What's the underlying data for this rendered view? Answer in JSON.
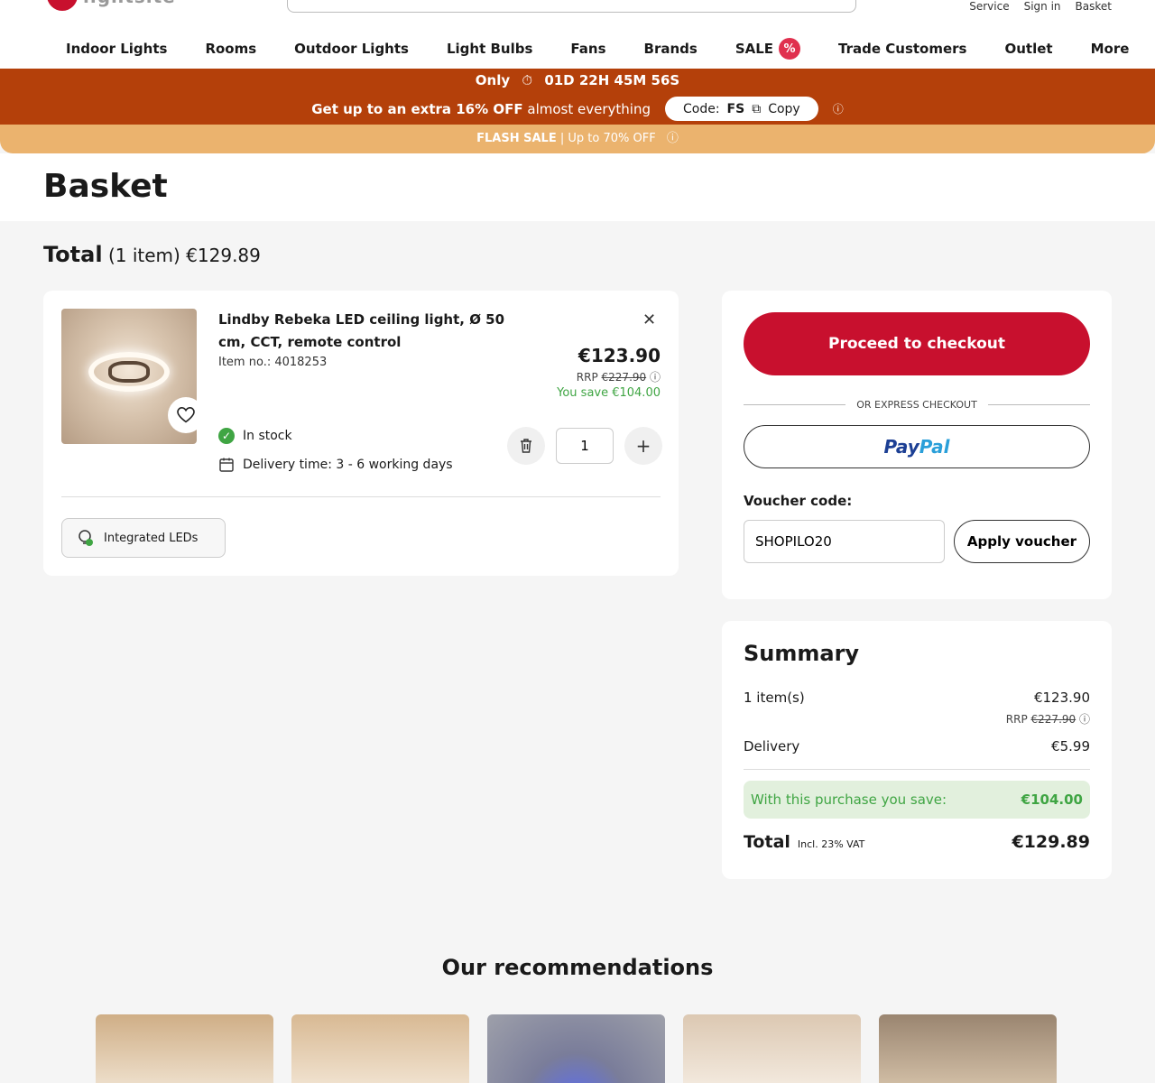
{
  "header": {
    "logo_text": "lightsite",
    "top_links": [
      "Service",
      "Sign in",
      "Basket"
    ],
    "nav": [
      "Indoor Lights",
      "Rooms",
      "Outdoor Lights",
      "Light Bulbs",
      "Fans",
      "Brands",
      "SALE",
      "Trade Customers",
      "Outlet",
      "More"
    ],
    "sale_badge": "%"
  },
  "promo": {
    "only": "Only",
    "countdown": "01D 22H 45M 56S",
    "offer_bold": "Get up to an extra 16% OFF",
    "offer_rest": "almost everything",
    "code_label": "Code:",
    "code": "FS",
    "copy_label": "Copy",
    "flash_bold": "FLASH SALE",
    "flash_rest": "| Up to 70% OFF"
  },
  "page": {
    "title": "Basket",
    "total_label": "Total",
    "total_count": "(1 item)",
    "total_amount": "€129.89"
  },
  "item": {
    "name": "Lindby Rebeka LED ceiling light, Ø 50 cm, CCT, remote control",
    "item_no": "Item no.: 4018253",
    "price": "€123.90",
    "rrp_label": "RRP",
    "rrp_value": "€227.90",
    "save": "You save €104.00",
    "stock": "In stock",
    "delivery": "Delivery time: 3 - 6 working days",
    "quantity": "1",
    "feature": "Integrated LEDs"
  },
  "checkout": {
    "proceed": "Proceed to checkout",
    "express": "OR EXPRESS CHECKOUT",
    "paypal_a": "Pay",
    "paypal_b": "Pal",
    "voucher_label": "Voucher code:",
    "voucher_value": "SHOPILO20",
    "apply": "Apply voucher"
  },
  "summary": {
    "title": "Summary",
    "items_label": "1 item(s)",
    "items_value": "€123.90",
    "rrp_label": "RRP",
    "rrp_value": "€227.90",
    "delivery_label": "Delivery",
    "delivery_value": "€5.99",
    "save_label": "With this purchase you save:",
    "save_value": "€104.00",
    "total_label": "Total",
    "vat": "Incl. 23% VAT",
    "total_value": "€129.89"
  },
  "recommendations": {
    "title": "Our recommendations"
  },
  "colors": {
    "brand_red": "#c8102e",
    "promo_orange": "#b4400a",
    "flash": "#ebb36e",
    "save_green": "#3fa543"
  }
}
